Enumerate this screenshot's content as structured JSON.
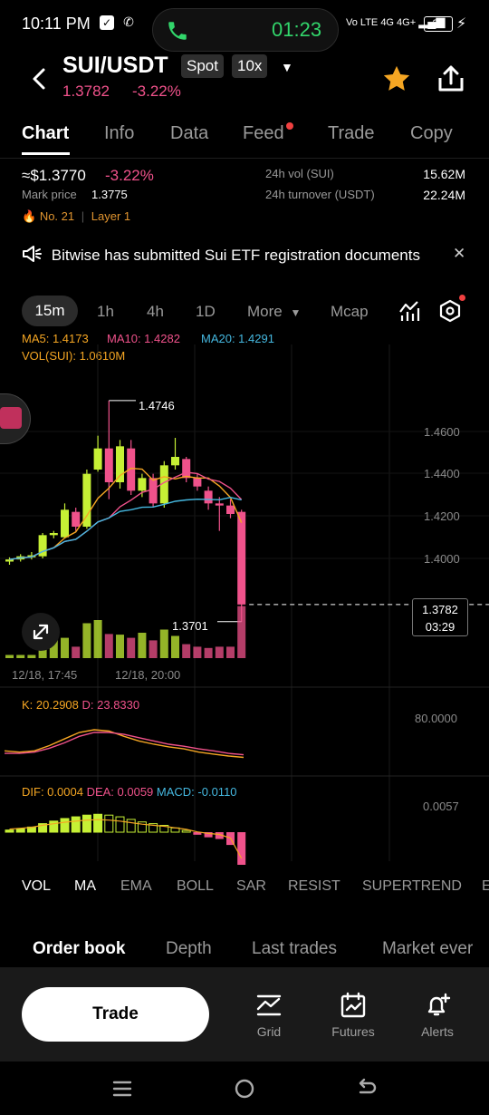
{
  "status_bar": {
    "time": "10:11 PM",
    "call_timer": "01:23",
    "network": "Vo LTE 4G 4G+",
    "battery": "28"
  },
  "header": {
    "pair": "SUI/USDT",
    "market_type": "Spot",
    "leverage": "10x",
    "price": "1.3782",
    "change": "-3.22%"
  },
  "tabs": [
    "Chart",
    "Info",
    "Data",
    "Feed",
    "Trade",
    "Copy"
  ],
  "summary": {
    "price": "≈$1.3770",
    "change": "-3.22%",
    "mark_label": "Mark price",
    "mark_value": "1.3775",
    "vol_label": "24h vol (SUI)",
    "vol_value": "15.62M",
    "turnover_label": "24h turnover (USDT)",
    "turnover_value": "22.24M",
    "rank": "No. 21",
    "category": "Layer 1"
  },
  "news": {
    "text": "Bitwise has submitted Sui ETF registration documents"
  },
  "intervals": {
    "active": "15m",
    "items": [
      "1h",
      "4h",
      "1D",
      "More",
      "Mcap"
    ]
  },
  "legend": {
    "ma5": "MA5: 1.4173",
    "ma10": "MA10: 1.4282",
    "ma20": "MA20: 1.4291",
    "vol": "VOL(SUI): 1.0610M",
    "kdj_k": "K: 20.2908",
    "kdj_d": "D: 23.8330",
    "kdj_scale": "80.0000",
    "dif": "DIF: 0.0004",
    "dea": "DEA: 0.0059",
    "macd": "MACD: -0.0110",
    "macd_scale": "0.0057"
  },
  "colors": {
    "up": "#c6f035",
    "down": "#f0528b",
    "ma5": "#f5a623",
    "ma10": "#f0528b",
    "ma20": "#45b8e0",
    "accent_star": "#f5a623"
  },
  "chart_data": {
    "type": "candlestick",
    "pair": "SUI/USDT",
    "interval": "15m",
    "y_ticks": [
      "1.4600",
      "1.4400",
      "1.4200",
      "1.4000"
    ],
    "ylim": [
      1.37,
      1.48
    ],
    "x_ticks": [
      "12/18, 17:45",
      "12/18, 20:00"
    ],
    "high_label": "1.4746",
    "low_label": "1.3701",
    "last_price": "1.3782",
    "countdown": "03:29",
    "candles": [
      {
        "o": 1.3985,
        "h": 1.4005,
        "l": 1.397,
        "c": 1.3995
      },
      {
        "o": 1.3995,
        "h": 1.402,
        "l": 1.3985,
        "c": 1.401
      },
      {
        "o": 1.4005,
        "h": 1.403,
        "l": 1.3995,
        "c": 1.4015
      },
      {
        "o": 1.401,
        "h": 1.412,
        "l": 1.4,
        "c": 1.411
      },
      {
        "o": 1.411,
        "h": 1.413,
        "l": 1.4095,
        "c": 1.412
      },
      {
        "o": 1.41,
        "h": 1.426,
        "l": 1.4095,
        "c": 1.423
      },
      {
        "o": 1.422,
        "h": 1.424,
        "l": 1.413,
        "c": 1.415
      },
      {
        "o": 1.415,
        "h": 1.442,
        "l": 1.414,
        "c": 1.44
      },
      {
        "o": 1.442,
        "h": 1.458,
        "l": 1.441,
        "c": 1.452
      },
      {
        "o": 1.452,
        "h": 1.4746,
        "l": 1.428,
        "c": 1.436
      },
      {
        "o": 1.436,
        "h": 1.456,
        "l": 1.433,
        "c": 1.453
      },
      {
        "o": 1.452,
        "h": 1.456,
        "l": 1.43,
        "c": 1.432
      },
      {
        "o": 1.432,
        "h": 1.44,
        "l": 1.429,
        "c": 1.438
      },
      {
        "o": 1.438,
        "h": 1.44,
        "l": 1.424,
        "c": 1.426
      },
      {
        "o": 1.426,
        "h": 1.446,
        "l": 1.424,
        "c": 1.444
      },
      {
        "o": 1.444,
        "h": 1.457,
        "l": 1.442,
        "c": 1.448
      },
      {
        "o": 1.447,
        "h": 1.448,
        "l": 1.436,
        "c": 1.438
      },
      {
        "o": 1.438,
        "h": 1.44,
        "l": 1.432,
        "c": 1.434
      },
      {
        "o": 1.432,
        "h": 1.434,
        "l": 1.423,
        "c": 1.426
      },
      {
        "o": 1.426,
        "h": 1.429,
        "l": 1.413,
        "c": 1.425
      },
      {
        "o": 1.425,
        "h": 1.428,
        "l": 1.419,
        "c": 1.421
      },
      {
        "o": 1.422,
        "h": 1.423,
        "l": 1.3701,
        "c": 1.3782
      }
    ],
    "volume_relative": [
      0.05,
      0.05,
      0.05,
      0.18,
      0.3,
      0.32,
      0.18,
      0.55,
      0.6,
      0.38,
      0.37,
      0.32,
      0.4,
      0.28,
      0.45,
      0.35,
      0.22,
      0.18,
      0.16,
      0.18,
      0.18,
      0.82
    ],
    "kdj": {
      "k": [
        30,
        28,
        30,
        38,
        48,
        58,
        62,
        60,
        52,
        45,
        40,
        36,
        33,
        28,
        25,
        22,
        20
      ],
      "d": [
        26,
        26,
        28,
        34,
        42,
        52,
        58,
        58,
        55,
        50,
        45,
        40,
        37,
        33,
        30,
        26,
        24
      ]
    },
    "macd_hist": [
      0.0005,
      0.0008,
      0.0012,
      0.002,
      0.0026,
      0.0032,
      0.0036,
      0.004,
      0.0042,
      0.004,
      0.0036,
      0.003,
      0.0024,
      0.002,
      0.0016,
      0.001,
      0.0004,
      -0.0006,
      -0.0012,
      -0.0016,
      -0.003,
      -0.011
    ]
  },
  "indicators": [
    "VOL",
    "MA",
    "EMA",
    "BOLL",
    "SAR",
    "RESIST",
    "SUPERTREND",
    "E"
  ],
  "orderbook_tabs": [
    "Order book",
    "Depth",
    "Last trades",
    "Market ever"
  ],
  "bottom_bar": {
    "trade": "Trade",
    "grid": "Grid",
    "futures": "Futures",
    "alerts": "Alerts"
  }
}
